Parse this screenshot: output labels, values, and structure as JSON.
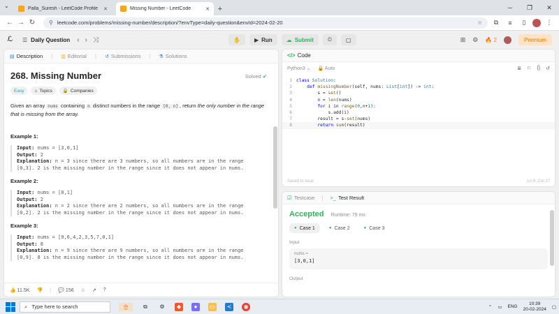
{
  "browser": {
    "tabs": [
      {
        "title": "Palla_Suresh - LeetCode Profile",
        "active": false
      },
      {
        "title": "Missing Number - LeetCode",
        "active": true
      }
    ],
    "url": "leetcode.com/problems/missing-number/description/?envType=daily-question&envId=2024-02-20"
  },
  "nav": {
    "daily_label": "Daily Question",
    "run_label": "Run",
    "submit_label": "Submit",
    "streak": "2",
    "premium_label": "Premium"
  },
  "left": {
    "tabs": [
      "Description",
      "Editorial",
      "Submissions",
      "Solutions"
    ],
    "title": "268. Missing Number",
    "status": "Solved",
    "chips": [
      "Easy",
      "Topics",
      "Companies"
    ],
    "desc_parts": {
      "p1": "Given an array ",
      "c1": "nums",
      "p2": " containing ",
      "c2": "n",
      "p3": " distinct numbers in the range ",
      "c3": "[0, n]",
      "p4": ", return ",
      "em": "the only number in the range that is missing from the array.",
      "p5": ""
    },
    "examples": [
      {
        "title": "Example 1:",
        "input": "nums = [3,0,1]",
        "output": "2",
        "explanation1": "n = 3 since there are 3 numbers, so all numbers are in the range",
        "explanation2": "[0,3]. 2 is the missing number in the range since it does not appear in nums."
      },
      {
        "title": "Example 2:",
        "input": "nums = [0,1]",
        "output": "2",
        "explanation1": "n = 2 since there are 2 numbers, so all numbers are in the range",
        "explanation2": "[0,2]. 2 is the missing number in the range since it does not appear in nums."
      },
      {
        "title": "Example 3:",
        "input": "nums = [9,6,4,2,3,5,7,0,1]",
        "output": "8",
        "explanation1": "n = 9 since there are 9 numbers, so all numbers are in the range",
        "explanation2": "[0,9]. 8 is the missing number in the range since it does not appear in nums."
      }
    ],
    "labels": {
      "input": "Input:",
      "output": "Output:",
      "explanation": "Explanation:"
    },
    "footer": {
      "likes": "11.5K",
      "comments": "156"
    }
  },
  "code": {
    "header": "Code",
    "language": "Python3",
    "mode": "Auto",
    "saved": "Saved to local",
    "cursor": "Ln 8, Col 27",
    "lines": [
      {
        "no": "1"
      },
      {
        "no": "2"
      },
      {
        "no": "3"
      },
      {
        "no": "4"
      },
      {
        "no": "5"
      },
      {
        "no": "6"
      },
      {
        "no": "7"
      },
      {
        "no": "8"
      }
    ]
  },
  "result": {
    "tabs": [
      "Testcase",
      "Test Result"
    ],
    "status": "Accepted",
    "runtime": "Runtime: 79 ms",
    "cases": [
      "Case 1",
      "Case 2",
      "Case 3"
    ],
    "input_label": "Input",
    "var_name": "nums =",
    "var_value": "[3,0,1]",
    "output_label": "Output"
  },
  "taskbar": {
    "search_placeholder": "Type here to search",
    "lang": "ENG",
    "time": "10:39",
    "date": "20-02-2024"
  }
}
